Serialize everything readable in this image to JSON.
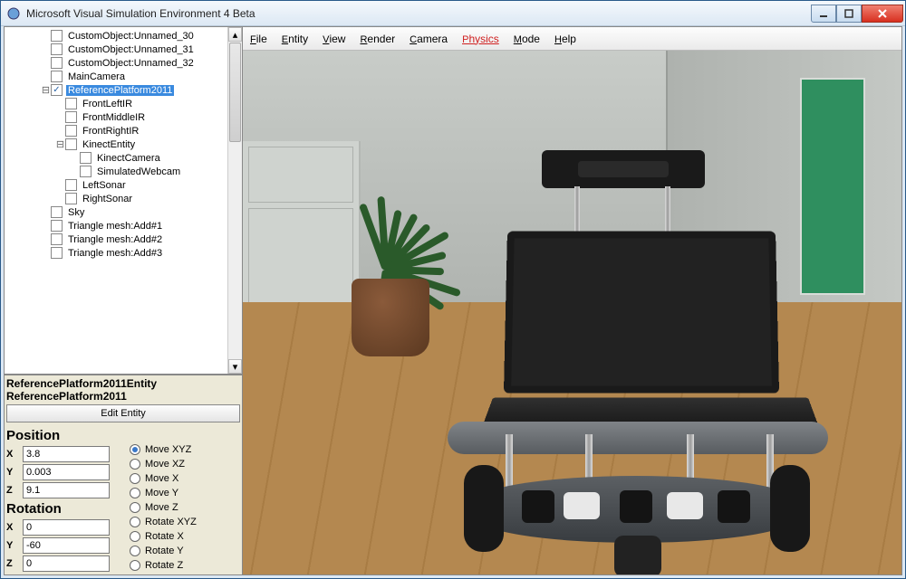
{
  "window": {
    "title": "Microsoft Visual Simulation Environment 4 Beta"
  },
  "titlebar_icons": {
    "min": "minimize-icon",
    "max": "maximize-icon",
    "close": "close-icon"
  },
  "menu": [
    "File",
    "Entity",
    "View",
    "Render",
    "Camera",
    "Physics",
    "Mode",
    "Help"
  ],
  "tree": {
    "items": [
      {
        "indent": 2,
        "label": "CustomObject:Unnamed_30"
      },
      {
        "indent": 2,
        "label": "CustomObject:Unnamed_31"
      },
      {
        "indent": 2,
        "label": "CustomObject:Unnamed_32"
      },
      {
        "indent": 2,
        "label": "MainCamera"
      },
      {
        "indent": 2,
        "label": "ReferencePlatform2011",
        "expander": "-",
        "checked": true,
        "selected": true
      },
      {
        "indent": 3,
        "label": "FrontLeftIR"
      },
      {
        "indent": 3,
        "label": "FrontMiddleIR"
      },
      {
        "indent": 3,
        "label": "FrontRightIR"
      },
      {
        "indent": 3,
        "label": "KinectEntity",
        "expander": "-"
      },
      {
        "indent": 4,
        "label": "KinectCamera"
      },
      {
        "indent": 4,
        "label": "SimulatedWebcam"
      },
      {
        "indent": 3,
        "label": "LeftSonar"
      },
      {
        "indent": 3,
        "label": "RightSonar"
      },
      {
        "indent": 2,
        "label": "Sky"
      },
      {
        "indent": 2,
        "label": "Triangle mesh:Add#1"
      },
      {
        "indent": 2,
        "label": "Triangle mesh:Add#2"
      },
      {
        "indent": 2,
        "label": "Triangle mesh:Add#3"
      }
    ]
  },
  "props": {
    "title1": "ReferencePlatform2011Entity",
    "title2": "ReferencePlatform2011",
    "edit_label": "Edit Entity",
    "position_head": "Position",
    "rotation_head": "Rotation",
    "axes": {
      "x": "X",
      "y": "Y",
      "z": "Z"
    },
    "position": {
      "x": "3.8",
      "y": "0.003",
      "z": "9.1"
    },
    "rotation": {
      "x": "0",
      "y": "-60",
      "z": "0"
    },
    "move_modes": [
      "Move XYZ",
      "Move XZ",
      "Move X",
      "Move Y",
      "Move Z",
      "Rotate XYZ",
      "Rotate X",
      "Rotate Y",
      "Rotate Z"
    ],
    "move_selected": 0
  }
}
